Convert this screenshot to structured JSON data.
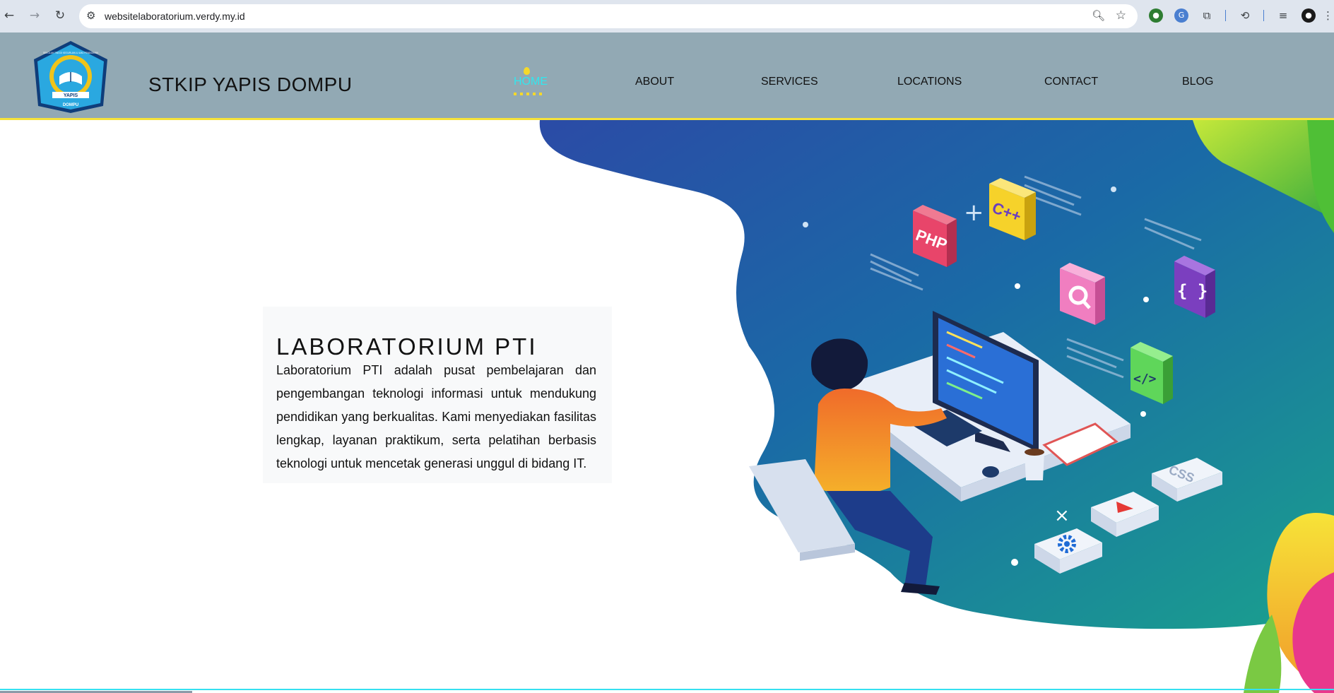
{
  "browser": {
    "url": "websitelaboratorium.verdy.my.id",
    "back_icon": "arrow-left-icon",
    "forward_icon": "arrow-right-icon",
    "reload_icon": "reload-icon"
  },
  "header": {
    "site_title": "STKIP YAPIS DOMPU",
    "logo_text_top": "SEKOLAH TINGGI KEGURUAN & ILMU PENDIDIKAN",
    "logo_text_banner": "YAPIS",
    "logo_text_bottom": "DOMPU",
    "menu": [
      {
        "label": "HOME",
        "active": true
      },
      {
        "label": "ABOUT",
        "active": false
      },
      {
        "label": "SERVICES",
        "active": false
      },
      {
        "label": "LOCATIONS",
        "active": false
      },
      {
        "label": "CONTACT",
        "active": false
      },
      {
        "label": "BLOG",
        "active": false
      }
    ],
    "accent_color": "#32e6ee",
    "highlight_color": "#f5d92a"
  },
  "hero": {
    "title": "LABORATORIUM PTI",
    "description": "Laboratorium PTI adalah pusat pembelajaran dan pengembangan teknologi informasi untuk mendukung pendidikan yang berkualitas. Kami menyediakan fasilitas lengkap, layanan praktikum, serta pelatihan berbasis teknologi untuk mencetak generasi unggul di bidang IT.",
    "art_labels": {
      "php": "PHP",
      "cpp": "C++",
      "css": "CSS",
      "braces": "{ }",
      "code": "</>"
    }
  }
}
